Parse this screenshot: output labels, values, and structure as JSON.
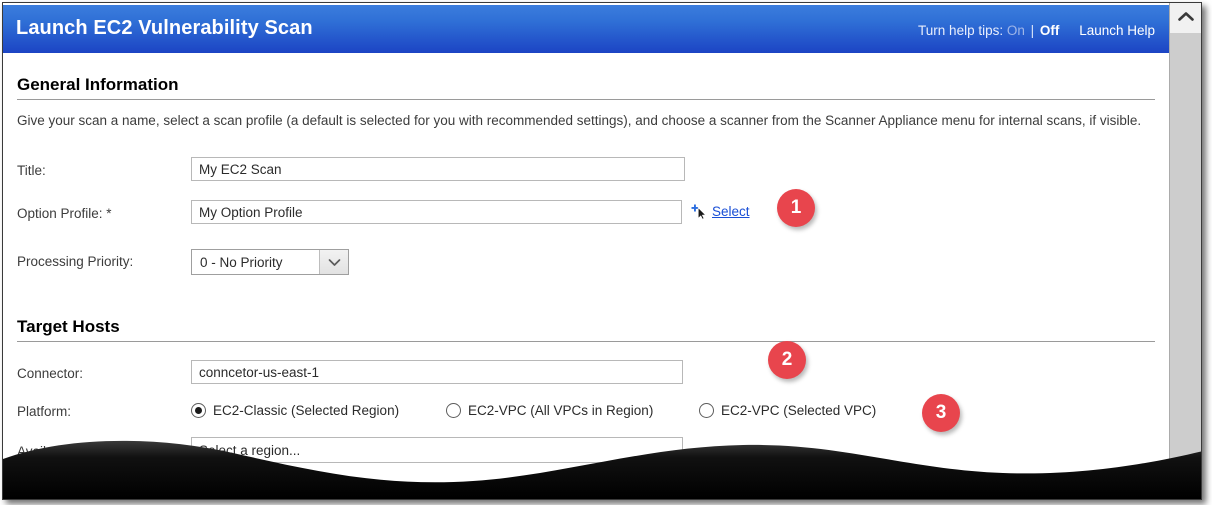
{
  "window": {
    "title": "Launch EC2 Vulnerability Scan",
    "help_tips_label": "Turn help tips:",
    "help_tips_on": "On",
    "help_tips_separator": "|",
    "help_tips_off": "Off",
    "launch_help": "Launch Help",
    "accent_blue": "#2f6fd6",
    "badge_red": "#e8454d",
    "link_blue": "#1a4fd6"
  },
  "general_information": {
    "heading": "General Information",
    "description": "Give your scan a name, select a scan profile (a default is selected for you with recommended settings), and choose a scanner from the Scanner Appliance menu for internal scans, if visible.",
    "title_field": {
      "label": "Title:",
      "value": "My EC2 Scan"
    },
    "option_profile_field": {
      "label": "Option Profile: *",
      "value": "My Option Profile",
      "select_link": "Select",
      "select_icon": "plus-cursor-icon"
    },
    "processing_priority_field": {
      "label": "Processing Priority:",
      "value": "0 - No Priority",
      "arrow_icon": "chevron-down-icon"
    }
  },
  "target_hosts": {
    "heading": "Target Hosts",
    "connector_field": {
      "label": "Connector:",
      "value": "conncetor-us-east-1"
    },
    "platform_field": {
      "label": "Platform:",
      "options": [
        {
          "label": "EC2-Classic (Selected Region)",
          "checked": true
        },
        {
          "label": "EC2-VPC (All VPCs in Region)",
          "checked": false
        },
        {
          "label": "EC2-VPC (Selected VPC)",
          "checked": false
        }
      ]
    },
    "available_regions_field": {
      "label": "Available Regions:",
      "value": "Select a region..."
    }
  },
  "callouts": [
    {
      "number": "1"
    },
    {
      "number": "2"
    },
    {
      "number": "3"
    }
  ],
  "scrollbar": {
    "up_arrow_icon": "chevron-up-icon"
  }
}
